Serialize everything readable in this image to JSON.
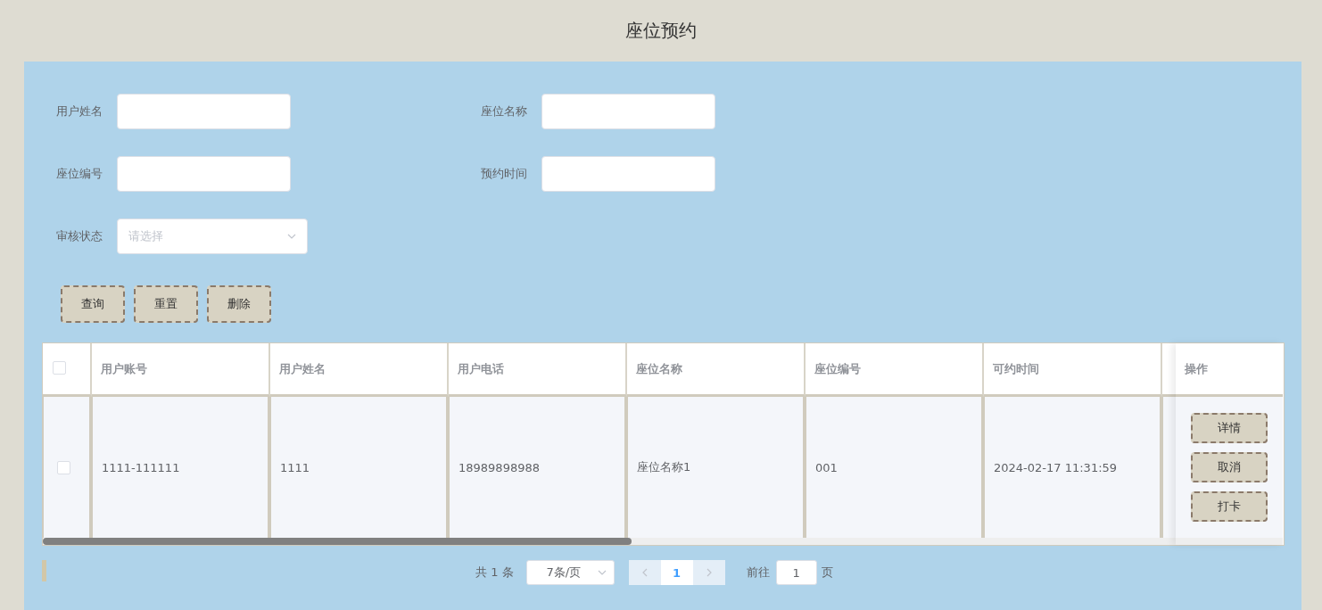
{
  "page": {
    "title": "座位预约"
  },
  "filters": [
    {
      "label": "用户姓名",
      "kind": "text"
    },
    {
      "label": "座位名称",
      "kind": "text"
    },
    {
      "label": "座位编号",
      "kind": "text"
    },
    {
      "label": "预约时间",
      "kind": "text"
    },
    {
      "label": "审核状态",
      "kind": "select",
      "placeholder": "请选择"
    }
  ],
  "actions": [
    "查询",
    "重置",
    "删除"
  ],
  "table": {
    "header_checked": false,
    "columns": [
      "用户账号",
      "用户姓名",
      "用户电话",
      "座位名称",
      "座位编号",
      "可约时间"
    ],
    "action_column": "操作",
    "rows": [
      {
        "checked": false,
        "cells": [
          "1111-111111",
          "1111",
          "18989898988",
          "座位名称1",
          "001",
          "2024-02-17 11:31:59"
        ],
        "actions": [
          "详情",
          "取消",
          "打卡"
        ]
      }
    ]
  },
  "pagination": {
    "total": "共 1 条",
    "page_size": "7条/页",
    "pages": [
      {
        "label": "1",
        "selected": true
      }
    ],
    "goto_label": "前往",
    "goto_value": "1",
    "goto_suffix": "页"
  }
}
